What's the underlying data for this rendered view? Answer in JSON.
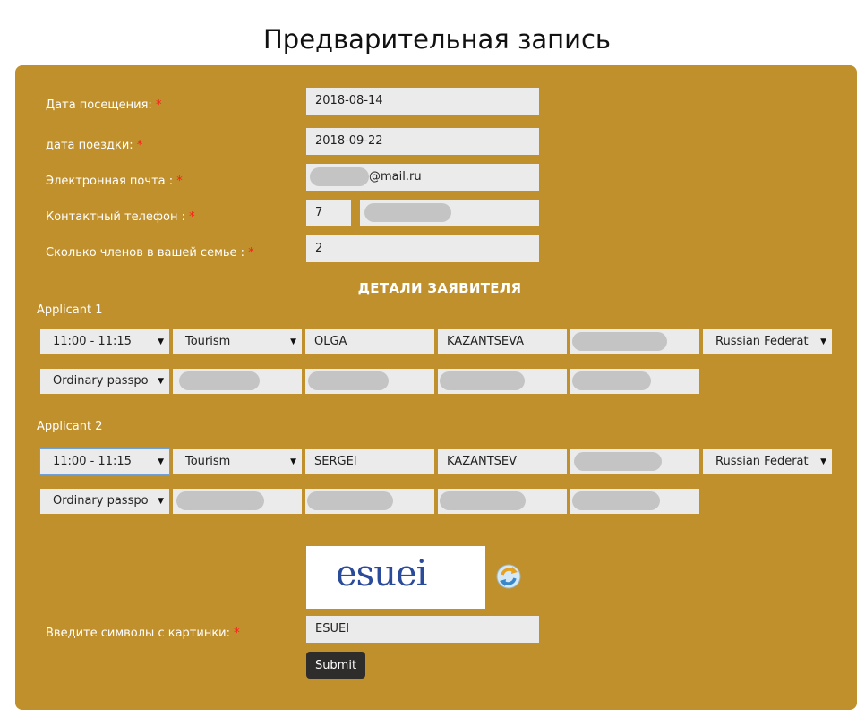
{
  "page": {
    "title": "Предварительная запись"
  },
  "form": {
    "visit_date": {
      "label": "Дата посещения:",
      "value": "2018-08-14"
    },
    "trip_date": {
      "label": "дата поездки:",
      "value": "2018-09-22"
    },
    "email": {
      "label": "Электронная почта :",
      "value_suffix": "@mail.ru"
    },
    "phone": {
      "label": "Контактный телефон :",
      "code": "7"
    },
    "family_size": {
      "label": "Сколько членов в вашей семье :",
      "value": "2"
    },
    "required_mark": "*"
  },
  "details_title": "ДЕТАЛИ ЗАЯВИТЕЛЯ",
  "applicants": [
    {
      "label": "Applicant 1",
      "time": "11:00 - 11:15",
      "purpose": "Tourism",
      "first_name": "OLGA",
      "last_name": "KAZANTSEVA",
      "country": "Russian Federat",
      "passport_type": "Ordinary passpo"
    },
    {
      "label": "Applicant 2",
      "time": "11:00 - 11:15",
      "purpose": "Tourism",
      "first_name": "SERGEI",
      "last_name": "KAZANTSEV",
      "country": "Russian Federat",
      "passport_type": "Ordinary passpo"
    }
  ],
  "captcha": {
    "image_text": "esuei",
    "label": "Введите символы с картинки:",
    "value": "ESUEI"
  },
  "submit_label": "Submit",
  "icons": {
    "refresh": "refresh-icon",
    "dropdown": "chevron-down-icon"
  }
}
